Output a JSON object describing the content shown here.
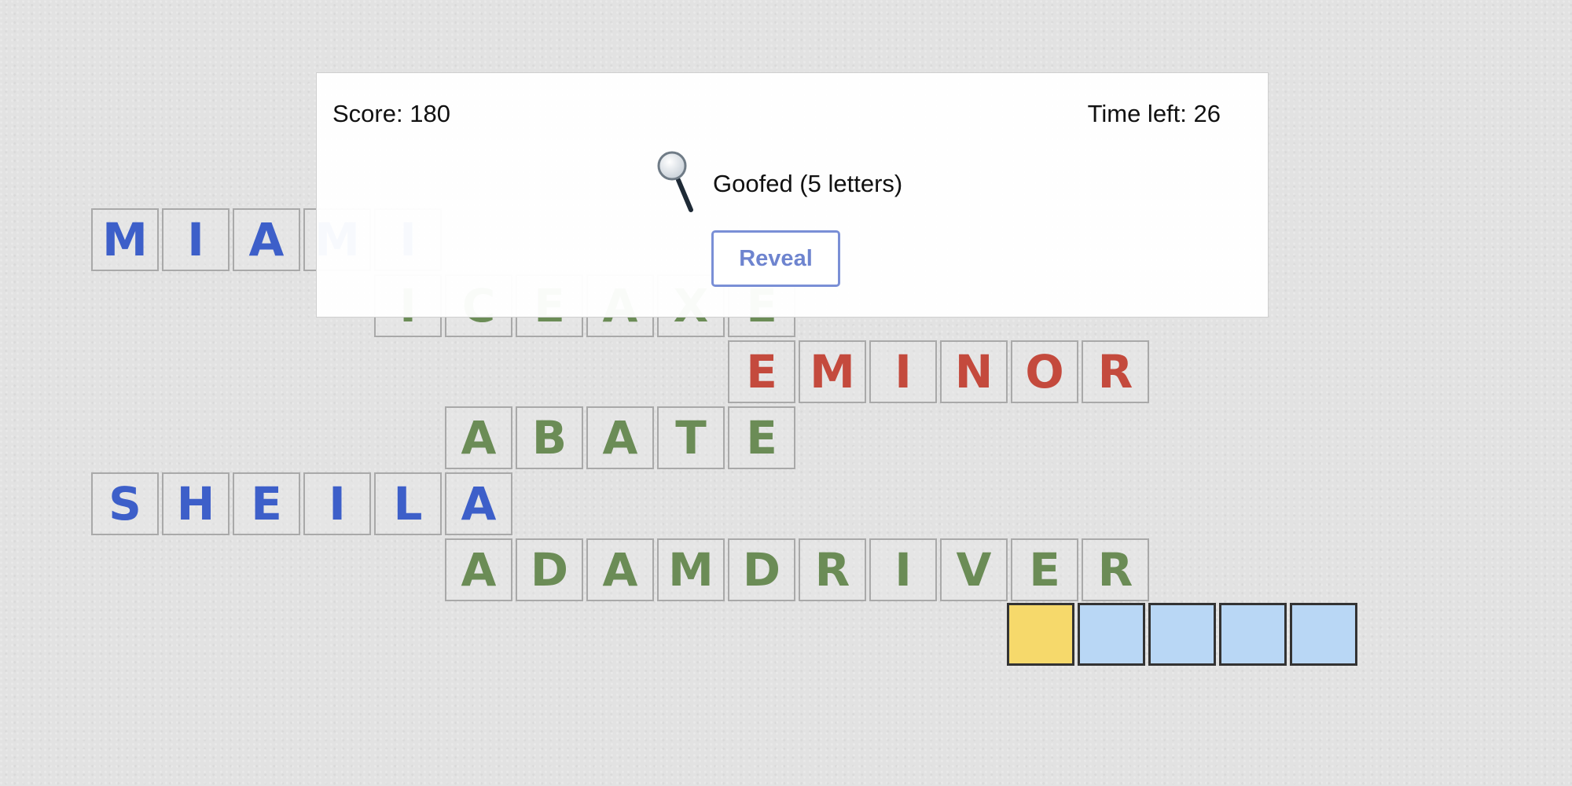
{
  "header": {
    "score_label": "Score: 180",
    "time_label": "Time left: 26"
  },
  "hint": {
    "icon": "magnifying-glass-icon",
    "clue": "Goofed (5 letters)",
    "reveal_label": "Reveal"
  },
  "colors": {
    "blue": "#3d5fc9",
    "green": "#6b8c56",
    "red": "#c44a3d",
    "active_cell": "#f6d96b",
    "empty_cell": "#b9d7f5"
  },
  "words": [
    {
      "id": "miami",
      "color": "blue",
      "letters": [
        "M",
        "I",
        "A",
        "M",
        "I"
      ]
    },
    {
      "id": "iceaxe",
      "color": "green",
      "letters": [
        "I",
        "C",
        "E",
        "A",
        "X",
        "E"
      ]
    },
    {
      "id": "eminor",
      "color": "red",
      "letters": [
        "E",
        "M",
        "I",
        "N",
        "O",
        "R"
      ]
    },
    {
      "id": "abate",
      "color": "green",
      "letters": [
        "A",
        "B",
        "A",
        "T",
        "E"
      ]
    },
    {
      "id": "sheila",
      "color": "blue",
      "letters": [
        "S",
        "H",
        "E",
        "I",
        "L",
        "A"
      ]
    },
    {
      "id": "adamdriver",
      "color": "green",
      "letters": [
        "A",
        "D",
        "A",
        "M",
        "D",
        "R",
        "I",
        "V",
        "E",
        "R"
      ]
    }
  ],
  "input_row": {
    "length": 5,
    "active_index": 0,
    "letters": [
      "",
      "",
      "",
      "",
      ""
    ]
  }
}
